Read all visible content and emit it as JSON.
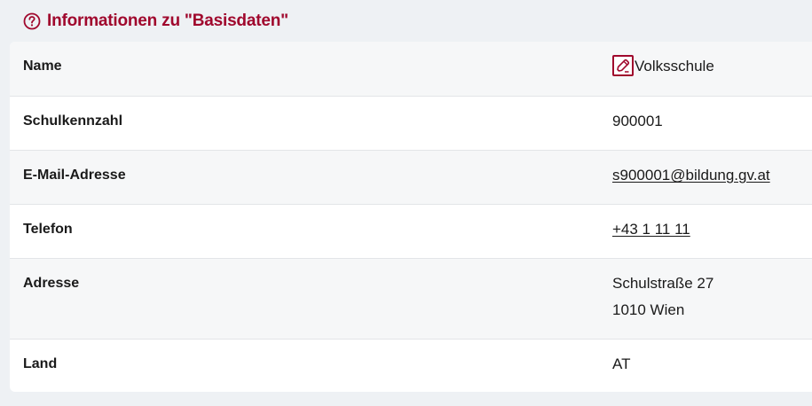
{
  "header": {
    "title": "Informationen zu \"Basisdaten\"",
    "icon": "help-circle-icon",
    "accent_color": "#a0082d"
  },
  "rows": [
    {
      "label": "Name",
      "value": "Volksschule",
      "edit_icon": "edit-pencil-icon"
    },
    {
      "label": "Schulkennzahl",
      "value": "900001"
    },
    {
      "label": "E-Mail-Adresse",
      "value": "s900001@bildung.gv.at"
    },
    {
      "label": "Telefon",
      "value": "+43 1 11 11"
    },
    {
      "label": "Adresse",
      "value_line1": "Schulstraße 27",
      "value_line2": "1010 Wien"
    },
    {
      "label": "Land",
      "value": "AT"
    }
  ]
}
